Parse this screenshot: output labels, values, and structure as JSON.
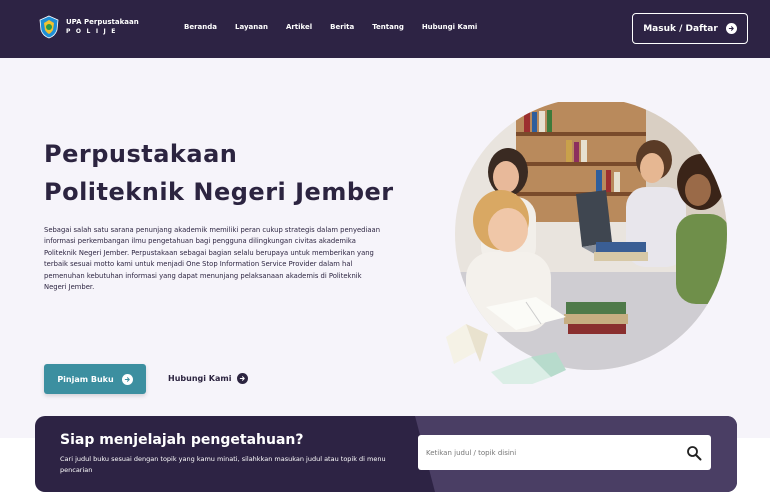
{
  "header": {
    "logo_title": "UPA Perpustakaan",
    "logo_subtitle": "POLIJE",
    "menu": [
      "Beranda",
      "Layanan",
      "Artikel",
      "Berita",
      "Tentang",
      "Hubungi Kami"
    ],
    "login_label": "Masuk / Daftar"
  },
  "hero": {
    "title_line1": "Perpustakaan",
    "title_line2": "Politeknik Negeri Jember",
    "description": "Sebagai salah satu sarana penunjang akademik memiliki peran cukup strategis dalam penyediaan informasi perkembangan ilmu pengetahuan bagi pengguna dilingkungan civitas akademika Politeknik Negeri Jember. Perpustakaan sebagai bagian selalu berupaya untuk memberikan yang terbaik sesuai motto kami untuk menjadi One Stop Information Service Provider dalam hal pemenuhan kebutuhan informasi yang dapat menunjang pelaksanaan akademis di Politeknik Negeri Jember.",
    "primary_button": "Pinjam Buku",
    "secondary_button": "Hubungi Kami"
  },
  "search_banner": {
    "title": "Siap menjelajah pengetahuan?",
    "description": "Cari judul buku sesuai dengan topik yang kamu minati, silahkkan masukan judul atau topik di menu pencarian",
    "placeholder": "Ketikan judul / topik disini"
  },
  "colors": {
    "navy": "#2d2344",
    "teal": "#3c8fa0",
    "background": "#f6f4fa"
  }
}
